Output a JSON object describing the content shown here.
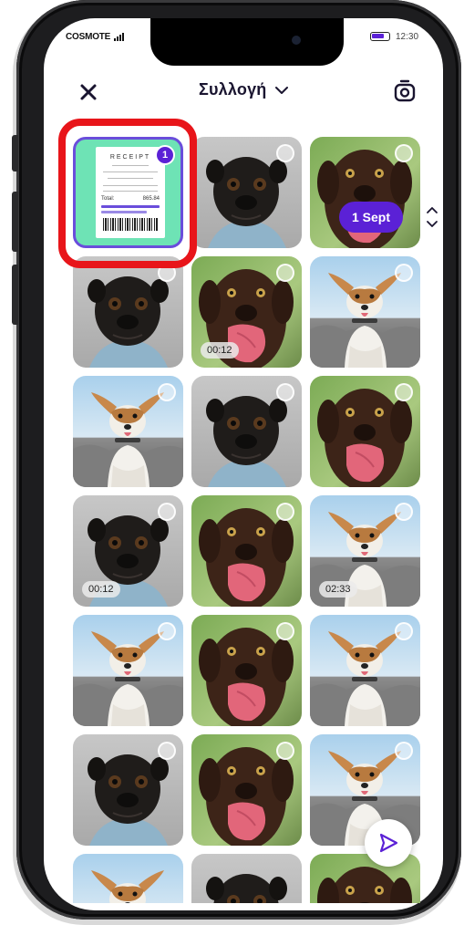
{
  "status_bar": {
    "carrier": "COSMOTE",
    "time": "12:30"
  },
  "header": {
    "title": "Συλλογή"
  },
  "first_tile": {
    "receipt_title": "RECEIPT",
    "total_label": "Total:",
    "total_value": "865.84",
    "selection_number": "1"
  },
  "date_pill": "1 Sept",
  "durations": {
    "d1": "00:12",
    "d2": "00:12",
    "d3": "02:33"
  },
  "colors": {
    "accent": "#5b21d6",
    "highlight": "#e8151a",
    "receipt_bg": "#6ee3b5"
  },
  "icons": [
    "close-icon",
    "chevron-down-icon",
    "camera-icon",
    "scroll-chevrons-icon",
    "send-icon"
  ]
}
